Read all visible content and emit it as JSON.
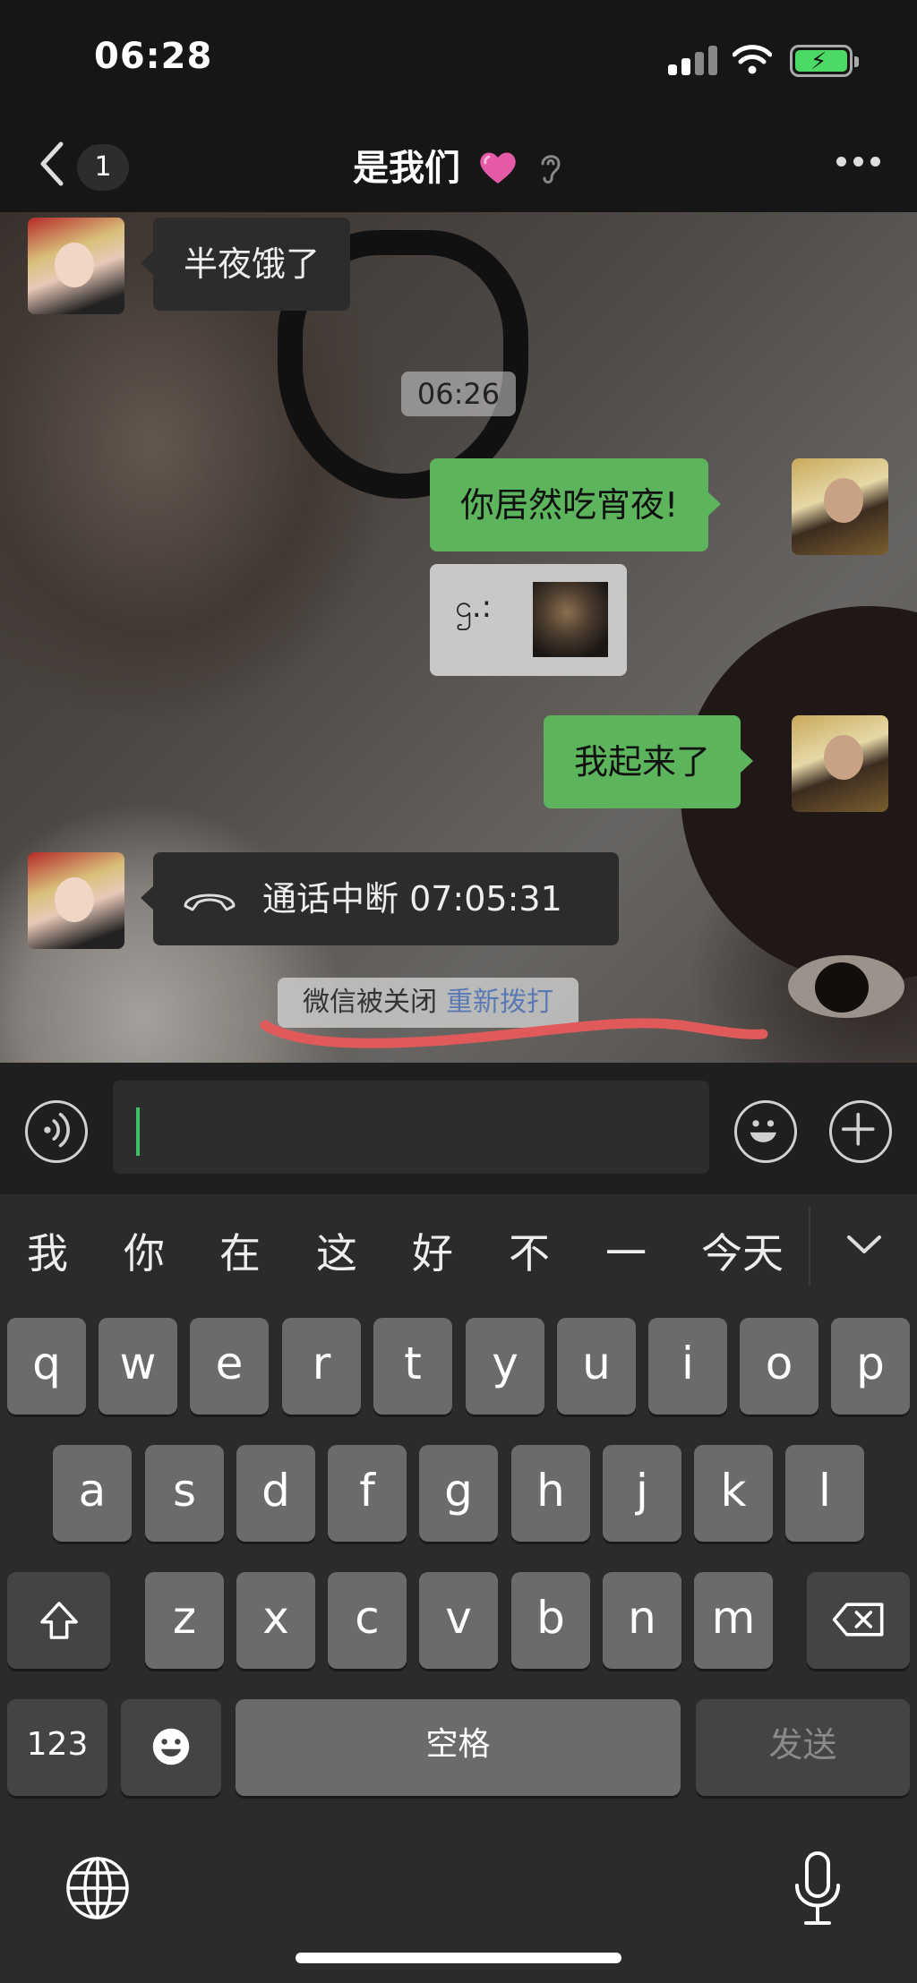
{
  "status_bar": {
    "time": "06:28"
  },
  "nav": {
    "unread_count": "1",
    "title": "是我们"
  },
  "chat": {
    "messages": {
      "m1": "半夜饿了",
      "timestamp": "06:26",
      "m2": "你居然吃宵夜!",
      "sticker_text": "ဌ.:",
      "m3": "我起来了",
      "call_status": "通话中断 07:05:31",
      "system_plain": "微信被关闭",
      "system_link": "重新拨打"
    }
  },
  "keyboard": {
    "candidates": [
      "我",
      "你",
      "在",
      "这",
      "好",
      "不",
      "一",
      "今天"
    ],
    "row1": [
      "q",
      "w",
      "e",
      "r",
      "t",
      "y",
      "u",
      "i",
      "o",
      "p"
    ],
    "row2": [
      "a",
      "s",
      "d",
      "f",
      "g",
      "h",
      "j",
      "k",
      "l"
    ],
    "row3": [
      "z",
      "x",
      "c",
      "v",
      "b",
      "n",
      "m"
    ],
    "numbers_label": "123",
    "space_label": "空格",
    "send_label": "发送"
  },
  "colors": {
    "accent_green": "#5cb55c",
    "link_blue": "#5a79b5",
    "annotation_red": "#e05a5a",
    "caret_green": "#3ec06b"
  },
  "icons": [
    "back-arrow-icon",
    "heart-icon",
    "ear-icon",
    "more-icon",
    "hang-up-icon",
    "voice-icon",
    "emoji-icon",
    "plus-icon",
    "chevron-down-icon",
    "shift-icon",
    "delete-icon",
    "globe-icon",
    "microphone-icon"
  ]
}
